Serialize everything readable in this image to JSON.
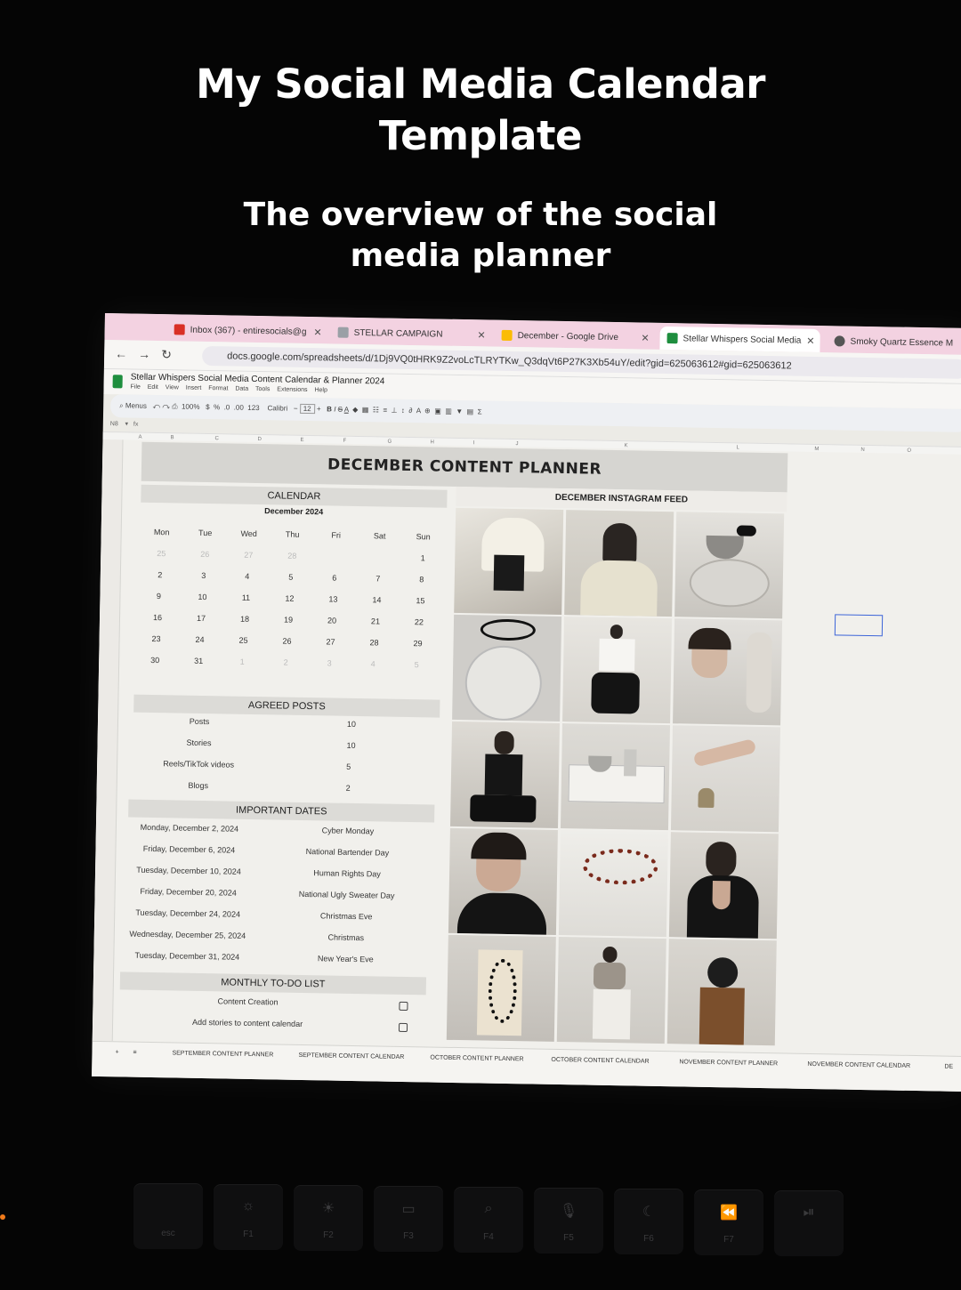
{
  "caption": {
    "title_line1": "My Social Media Calendar",
    "title_line2": "Template",
    "subtitle_line1": "The overview of the social",
    "subtitle_line2": "media planner"
  },
  "browser": {
    "tabs": [
      {
        "label": "Inbox (367) - entiresocials@g",
        "icon": "gmail-icon",
        "active": false
      },
      {
        "label": "STELLAR CAMPAIGN",
        "icon": "page-icon",
        "active": false
      },
      {
        "label": "December - Google Drive",
        "icon": "drive-icon",
        "active": false
      },
      {
        "label": "Stellar Whispers Social Media",
        "icon": "sheets-icon",
        "active": true
      },
      {
        "label": "Smoky Quartz Essence M",
        "icon": "globe-icon",
        "active": false
      }
    ],
    "url": "docs.google.com/spreadsheets/d/1Dj9VQ0tHRK9Z2voLcTLRYTKw_Q3dqVt6P27K3Xb54uY/edit?gid=625063612#gid=625063612"
  },
  "sheet": {
    "doc_title": "Stellar Whispers Social Media Content Calendar & Planner 2024",
    "menus": [
      "File",
      "Edit",
      "View",
      "Insert",
      "Format",
      "Data",
      "Tools",
      "Extensions",
      "Help"
    ],
    "toolbar": {
      "menus_search": "Menus",
      "zoom": "100%",
      "font": "Calibri",
      "font_size": "12"
    },
    "cell_ref": "N8",
    "columns": [
      "A",
      "B",
      "C",
      "D",
      "E",
      "F",
      "G",
      "H",
      "I",
      "J",
      "K",
      "L",
      "M",
      "N",
      "O"
    ]
  },
  "planner": {
    "title": "DECEMBER CONTENT PLANNER",
    "calendar_heading": "CALENDAR",
    "month": "December 2024",
    "weekdays": [
      "Mon",
      "Tue",
      "Wed",
      "Thu",
      "Fri",
      "Sat",
      "Sun"
    ],
    "weeks": [
      [
        "25",
        "26",
        "27",
        "28",
        "",
        "",
        "1"
      ],
      [
        "2",
        "3",
        "4",
        "5",
        "6",
        "7",
        "8"
      ],
      [
        "9",
        "10",
        "11",
        "12",
        "13",
        "14",
        "15"
      ],
      [
        "16",
        "17",
        "18",
        "19",
        "20",
        "21",
        "22"
      ],
      [
        "23",
        "24",
        "25",
        "26",
        "27",
        "28",
        "29"
      ],
      [
        "30",
        "31",
        "1",
        "2",
        "3",
        "4",
        "5"
      ]
    ],
    "agreed_heading": "AGREED POSTS",
    "agreed": [
      {
        "label": "Posts",
        "value": "10"
      },
      {
        "label": "Stories",
        "value": "10"
      },
      {
        "label": "Reels/TikTok videos",
        "value": "5"
      },
      {
        "label": "Blogs",
        "value": "2"
      }
    ],
    "dates_heading": "IMPORTANT DATES",
    "dates": [
      {
        "date": "Monday, December 2, 2024",
        "event": "Cyber Monday"
      },
      {
        "date": "Friday, December 6, 2024",
        "event": "National Bartender Day"
      },
      {
        "date": "Tuesday, December 10, 2024",
        "event": "Human Rights Day"
      },
      {
        "date": "Friday, December 20, 2024",
        "event": "National Ugly Sweater Day"
      },
      {
        "date": "Tuesday, December 24, 2024",
        "event": "Christmas Eve"
      },
      {
        "date": "Wednesday, December 25, 2024",
        "event": "Christmas"
      },
      {
        "date": "Tuesday, December 31, 2024",
        "event": "New Year's Eve"
      }
    ],
    "todo_heading": "MONTHLY TO-DO LIST",
    "todos": [
      "Content Creation",
      "Add stories to content calendar"
    ],
    "feed_heading": "DECEMBER INSTAGRAM FEED"
  },
  "sheet_tabs": [
    "SEPTEMBER CONTENT PLANNER",
    "SEPTEMBER CONTENT CALENDAR",
    "OCTOBER CONTENT PLANNER",
    "OCTOBER CONTENT CALENDAR",
    "NOVEMBER CONTENT PLANNER",
    "NOVEMBER CONTENT CALENDAR",
    "DE"
  ],
  "keyboard": [
    {
      "label": "esc",
      "icon": ""
    },
    {
      "label": "F1",
      "icon": "☼"
    },
    {
      "label": "F2",
      "icon": "☀"
    },
    {
      "label": "F3",
      "icon": "▭"
    },
    {
      "label": "F4",
      "icon": "⌕"
    },
    {
      "label": "F5",
      "icon": "🎙"
    },
    {
      "label": "F6",
      "icon": "☾"
    },
    {
      "label": "F7",
      "icon": "⏪"
    },
    {
      "label": "",
      "icon": "⏯"
    }
  ]
}
